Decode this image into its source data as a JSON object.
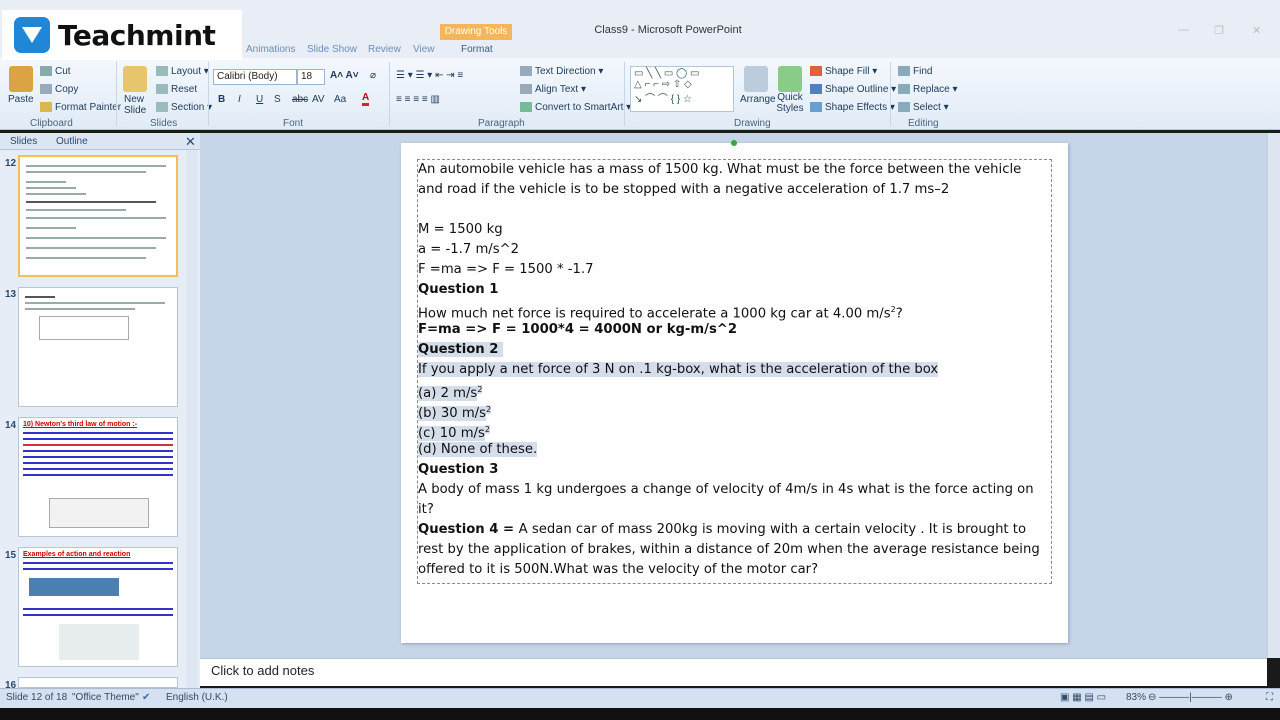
{
  "branding": {
    "logo_text": "Teachmint"
  },
  "window": {
    "title": "Class9 - Microsoft PowerPoint",
    "context_tab": "Drawing Tools",
    "context_subtab": "Format"
  },
  "tabs": [
    "Animations",
    "Slide Show",
    "Review",
    "View"
  ],
  "ribbon": {
    "clipboard": {
      "paste": "Paste",
      "cut": "Cut",
      "copy": "Copy",
      "format_painter": "Format Painter",
      "label": "Clipboard"
    },
    "slides": {
      "new_slide": "New Slide",
      "layout": "Layout",
      "reset": "Reset",
      "section": "Section",
      "label": "Slides"
    },
    "font": {
      "family": "Calibri (Body)",
      "size": "18",
      "label": "Font"
    },
    "paragraph": {
      "text_direction": "Text Direction",
      "align_text": "Align Text",
      "smartart": "Convert to SmartArt",
      "label": "Paragraph"
    },
    "drawing": {
      "arrange": "Arrange",
      "quick_styles": "Quick Styles",
      "shape_fill": "Shape Fill",
      "shape_outline": "Shape Outline",
      "shape_effects": "Shape Effects",
      "label": "Drawing"
    },
    "editing": {
      "find": "Find",
      "replace": "Replace",
      "select": "Select",
      "label": "Editing"
    }
  },
  "left_panel": {
    "tabs": [
      "Slides",
      "Outline"
    ],
    "slide_numbers": [
      "12",
      "13",
      "14",
      "15",
      "16"
    ],
    "thumb14_title": "10) Newton's third law of motion :-",
    "thumb15_title": "Examples of action and reaction"
  },
  "slide": {
    "lines": [
      "An automobile vehicle has a mass of 1500 kg. What must be the force between the vehicle",
      "and road if the vehicle is to be stopped with a negative acceleration of 1.7 ms–2",
      "M = 1500 kg",
      " a = -1.7 m/s^2",
      "F =ma => F = 1500 * -1.7",
      "Question 1",
      "How much net force is required to accelerate a 1000 kg car at 4.00 m/s",
      "2",
      "?",
      " F=ma => F = 1000*4 = 4000N or kg-m/s^2",
      "Question 2",
      "If you apply a net force of 3 N on .1 kg-box, what is the acceleration of the box",
      "(a) 2 m/s",
      "(b) 30 m/s",
      "(c) 10 m/s",
      "(d) None of these.",
      "Question 3",
      "A body of mass 1 kg undergoes a change of velocity of 4m/s in 4s what is the force acting on",
      "it?",
      "Question 4 = ",
      "A sedan car of mass 200kg is moving with a certain velocity . It is brought to",
      "rest by the application of brakes, within a distance of 20m when the average resistance being",
      "offered to it is 500N.What was the velocity of the motor car?"
    ]
  },
  "notes_placeholder": "Click to add notes",
  "status": {
    "slide_info": "Slide 12 of 18",
    "theme": "\"Office Theme\"",
    "language": "English (U.K.)",
    "zoom": "83%"
  }
}
